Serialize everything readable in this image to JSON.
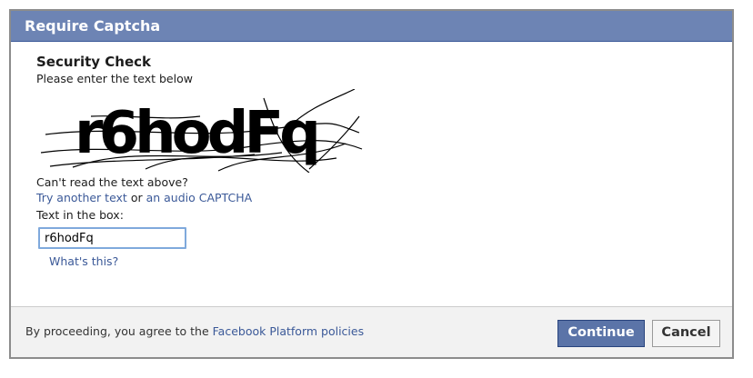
{
  "dialog": {
    "title": "Require Captcha",
    "heading": "Security Check",
    "instruction": "Please enter the text below",
    "captcha_text": "r6hodFq",
    "cant_read": "Can't read the text above?",
    "try_another_link": "Try another text",
    "or_text": " or ",
    "audio_link": "an audio CAPTCHA",
    "box_label": "Text in the box:",
    "input_value": "r6hodFq",
    "whats_this_link": "What's this?"
  },
  "footer": {
    "text_prefix": "By proceeding, you agree to the ",
    "policy_link": "Facebook Platform policies",
    "continue_label": "Continue",
    "cancel_label": "Cancel"
  },
  "colors": {
    "titlebar": "#6d84b4",
    "link": "#3b5998",
    "continue_button": "#5b74a8",
    "footer_background": "#f2f2f2"
  }
}
